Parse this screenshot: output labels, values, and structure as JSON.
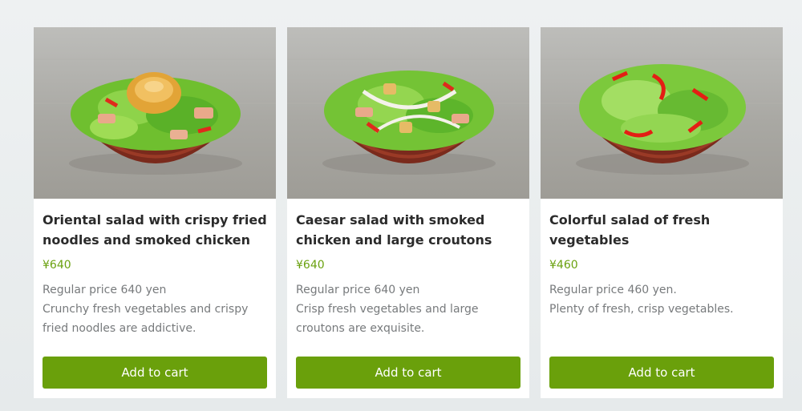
{
  "products": [
    {
      "image": "salad-bowl-with-crispy-noodles-image",
      "title": "Oriental salad with crispy fried noodles and smoked chicken",
      "price": "¥640",
      "description": [
        "Regular price 640 yen",
        "Crunchy fresh vegetables and crispy fried noodles are addictive."
      ],
      "button": "Add to cart"
    },
    {
      "image": "caesar-salad-bowl-image",
      "title": "Caesar salad with smoked chicken and large croutons",
      "price": "¥640",
      "description": [
        "Regular price 640 yen",
        "Crisp fresh vegetables and large croutons are exquisite."
      ],
      "button": "Add to cart"
    },
    {
      "image": "fresh-vegetable-salad-bowl-image",
      "title": "Colorful salad of fresh vegetables",
      "price": "¥460",
      "description": [
        "Regular price 460 yen.",
        "Plenty of fresh, crisp vegetables."
      ],
      "button": "Add to cart"
    }
  ],
  "colors": {
    "accent": "#6aa00b",
    "price": "#6aa10f",
    "title": "#2b2b2b",
    "description": "#777a7c"
  }
}
